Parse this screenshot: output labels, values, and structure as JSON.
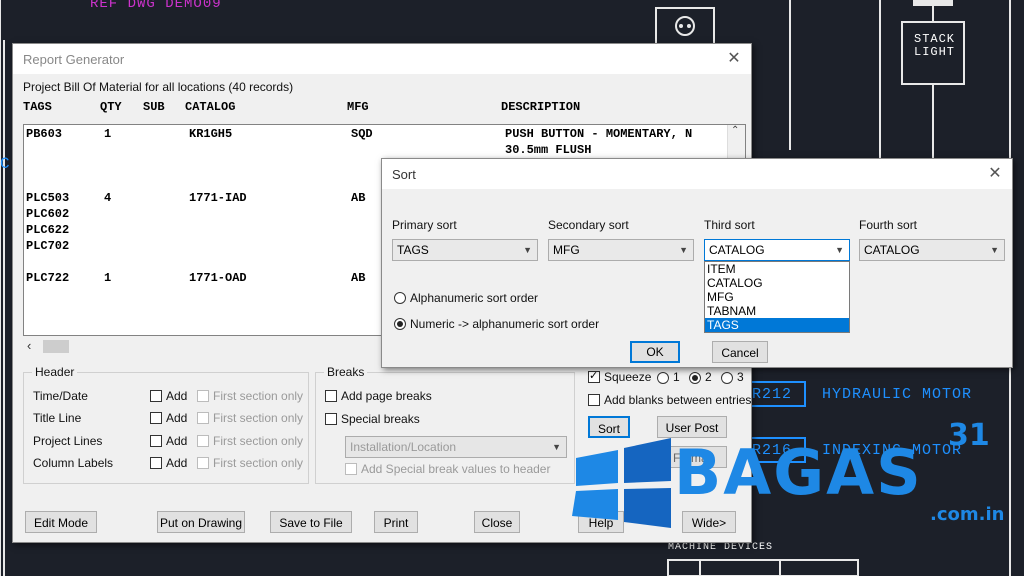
{
  "cad": {
    "ref_text": "REF  DWG  DEMO09",
    "stack_light_line1": "STACK",
    "stack_light_line2": "LIGHT",
    "hydraulic_motor": "HYDRAULIC  MOTOR",
    "indexing_motor": "INDEXING  MOTOR",
    "tag_r212": "R212",
    "tag_r216": "R216",
    "machine_devices": "MACHINE  DEVICES",
    "left_letter": "C",
    "line_color": "#e8e8e8",
    "accent_color": "#1e90ff",
    "magenta_color": "#cc33cc"
  },
  "watermark": {
    "brand": "BAGAS",
    "superscript": "31",
    "domain": ".com.in"
  },
  "report": {
    "title": "Report Generator",
    "summary": "Project Bill Of Material for all locations (40 records)",
    "columns": [
      "TAGS",
      "QTY",
      "SUB",
      "CATALOG",
      "MFG",
      "DESCRIPTION"
    ],
    "rows": [
      {
        "tags": [
          "PB603"
        ],
        "qty": "1",
        "catalog": "KR1GH5",
        "mfg": "SQD",
        "desc": [
          "PUSH BUTTON - MOMENTARY, N",
          "30.5mm FLUSH"
        ]
      },
      {
        "tags": [
          "PLC503",
          "PLC602",
          "PLC622",
          "PLC702"
        ],
        "qty": "4",
        "catalog": "1771-IAD",
        "mfg": "AB",
        "desc": []
      },
      {
        "tags": [
          "PLC722"
        ],
        "qty": "1",
        "catalog": "1771-OAD",
        "mfg": "AB",
        "desc": []
      }
    ],
    "header_group": {
      "title": "Header",
      "items": [
        {
          "label": "Time/Date",
          "add": "Add",
          "first": "First section only"
        },
        {
          "label": "Title Line",
          "add": "Add",
          "first": "First section only"
        },
        {
          "label": "Project Lines",
          "add": "Add",
          "first": "First section only"
        },
        {
          "label": "Column Labels",
          "add": "Add",
          "first": "First section only"
        }
      ]
    },
    "breaks_group": {
      "title": "Breaks",
      "add_page_breaks": "Add page breaks",
      "special_breaks": "Special breaks",
      "break_select": "Installation/Location",
      "add_special": "Add Special break values to header"
    },
    "squeeze": "Squeeze",
    "squeeze_options": [
      "1",
      "2",
      "3"
    ],
    "add_blanks": "Add blanks between entries",
    "sort_btn": "Sort",
    "user_post_btn": "User Post",
    "format_btn": "Format",
    "buttons": {
      "edit_mode": "Edit Mode",
      "put_on_drawing": "Put on Drawing",
      "save_to_file": "Save to File",
      "print": "Print",
      "close": "Close",
      "help": "Help",
      "wide": "Wide>"
    }
  },
  "sort": {
    "title": "Sort",
    "primary_label": "Primary sort",
    "secondary_label": "Secondary sort",
    "third_label": "Third sort",
    "fourth_label": "Fourth sort",
    "primary_value": "TAGS",
    "secondary_value": "MFG",
    "third_value": "CATALOG",
    "fourth_value": "CATALOG",
    "options": [
      "ITEM",
      "CATALOG",
      "MFG",
      "TABNAM",
      "TAGS"
    ],
    "selected_option": "TAGS",
    "alpha_order": "Alphanumeric sort order",
    "numeric_order": "Numeric -> alphanumeric sort order",
    "ok": "OK",
    "cancel": "Cancel"
  }
}
